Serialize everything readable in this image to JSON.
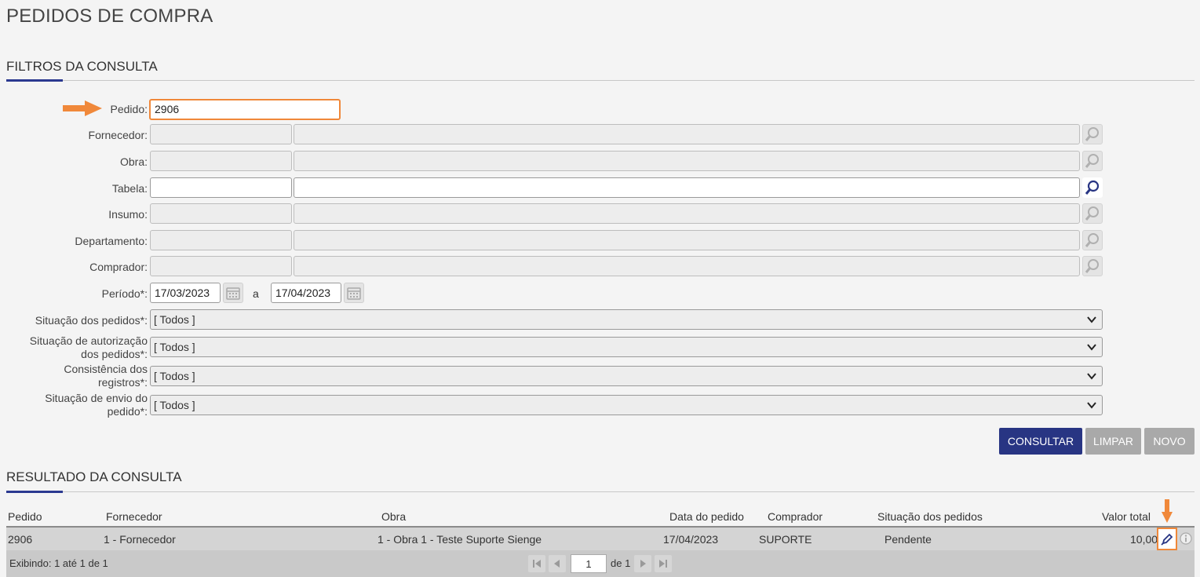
{
  "page": {
    "title": "PEDIDOS DE COMPRA"
  },
  "filters": {
    "section_title": "FILTROS DA CONSULTA",
    "pedido": {
      "label": "Pedido:",
      "value": "2906"
    },
    "fornecedor": {
      "label": "Fornecedor:"
    },
    "obra": {
      "label": "Obra:"
    },
    "tabela": {
      "label": "Tabela:"
    },
    "insumo": {
      "label": "Insumo:"
    },
    "departamento": {
      "label": "Departamento:"
    },
    "comprador": {
      "label": "Comprador:"
    },
    "periodo": {
      "label": "Período*:",
      "start": "17/03/2023",
      "sep": "a",
      "end": "17/04/2023"
    },
    "situacao_pedidos": {
      "label": "Situação dos pedidos*:",
      "value": "[ Todos ]"
    },
    "situacao_autorizacao": {
      "label_line1": "Situação de autorização",
      "label_line2": "dos pedidos*:",
      "value": "[ Todos ]"
    },
    "consistencia": {
      "label_line1": "Consistência dos",
      "label_line2": "registros*:",
      "value": "[ Todos ]"
    },
    "situacao_envio": {
      "label_line1": "Situação de envio do",
      "label_line2": "pedido*:",
      "value": "[ Todos ]"
    }
  },
  "actions": {
    "consultar": "CONSULTAR",
    "limpar": "LIMPAR",
    "novo": "NOVO"
  },
  "results": {
    "section_title": "RESULTADO DA CONSULTA",
    "columns": [
      "Pedido",
      "Fornecedor",
      "Obra",
      "Data do pedido",
      "Comprador",
      "Situação dos pedidos",
      "Valor total"
    ],
    "rows": [
      {
        "pedido": "2906",
        "fornecedor": "1 - Fornecedor",
        "obra": "1 - Obra 1 - Teste Suporte Sienge",
        "data": "17/04/2023",
        "comprador": "SUPORTE",
        "situacao": "Pendente",
        "valor": "10,00"
      }
    ],
    "footer": {
      "prefix": "Exibindo: ",
      "range": "1 até 1",
      "of": " de ",
      "total": "1"
    },
    "pager": {
      "page": "1",
      "of_label": "de 1"
    }
  },
  "colors": {
    "accent": "#283583",
    "highlight": "#f0883a"
  },
  "icons": [
    "arrow-right-icon",
    "search-icon",
    "calendar-icon",
    "chevron-down-icon",
    "pencil-icon",
    "info-icon",
    "arrow-down-icon",
    "first-page-icon",
    "prev-page-icon",
    "next-page-icon",
    "last-page-icon"
  ]
}
